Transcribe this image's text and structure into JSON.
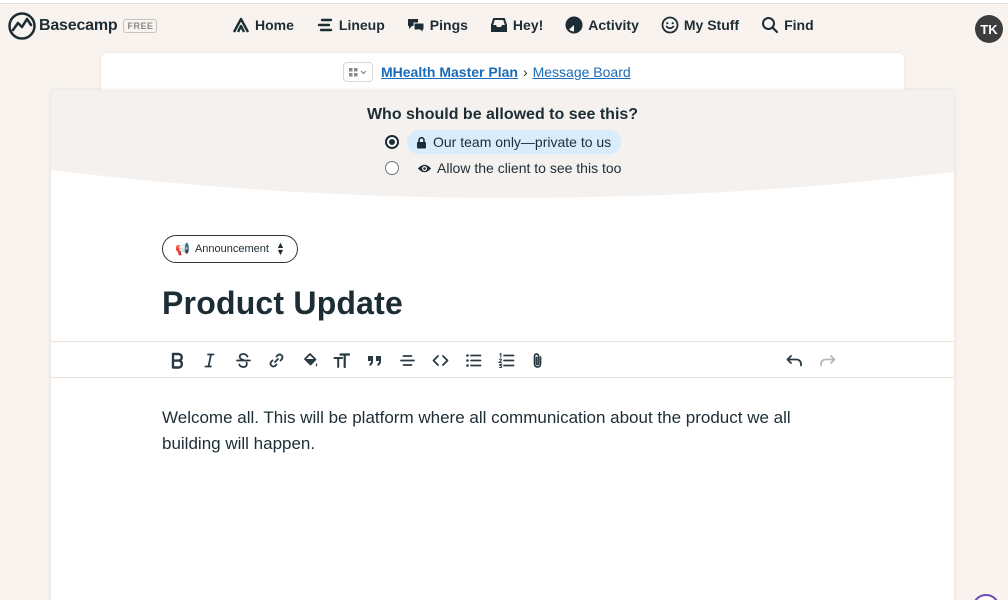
{
  "nav": {
    "logo_text": "Basecamp",
    "plan_badge": "FREE",
    "items": [
      {
        "label": "Home",
        "icon": "home-icon"
      },
      {
        "label": "Lineup",
        "icon": "lineup-icon"
      },
      {
        "label": "Pings",
        "icon": "pings-icon"
      },
      {
        "label": "Hey!",
        "icon": "hey-icon"
      },
      {
        "label": "Activity",
        "icon": "activity-icon"
      },
      {
        "label": "My Stuff",
        "icon": "my-stuff-icon"
      },
      {
        "label": "Find",
        "icon": "search-icon"
      }
    ],
    "avatar_initials": "TK"
  },
  "breadcrumb": {
    "project": "MHealth Master Plan",
    "separator": "›",
    "section": "Message Board"
  },
  "privacy": {
    "question": "Who should be allowed to see this?",
    "options": [
      {
        "label": "Our team only—private to us",
        "selected": true,
        "icon": "lock-icon"
      },
      {
        "label": "Allow the client to see this too",
        "selected": false,
        "icon": "eye-icon"
      }
    ]
  },
  "message": {
    "category": "Announcement",
    "title": "Product Update",
    "body": "Welcome all. This will be platform where all communication about the product we all building will happen."
  },
  "toolbar": {
    "tools": [
      "bold",
      "italic",
      "strikethrough",
      "link",
      "highlight",
      "heading",
      "quote",
      "horizontal-rule",
      "code",
      "bullet-list",
      "numbered-list",
      "attach",
      "undo",
      "redo"
    ]
  },
  "colors": {
    "accent_link": "#1a6bb8",
    "selected_option_bg": "#d8ecfb",
    "page_bg": "#f8f3ee"
  }
}
